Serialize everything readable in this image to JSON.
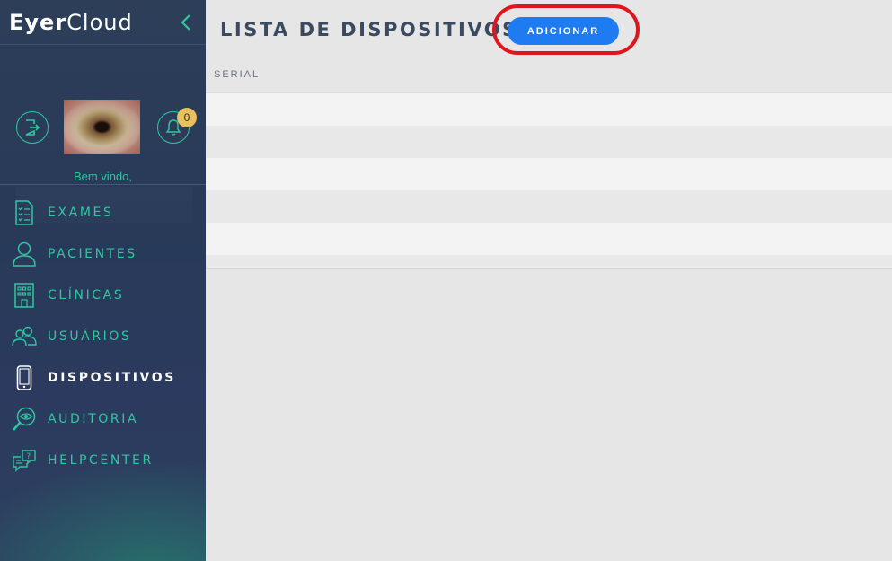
{
  "app": {
    "logo_bold": "Eyer",
    "logo_light": "Cloud"
  },
  "profile": {
    "welcome_text": "Bem vindo,",
    "notification_count": "0"
  },
  "sidebar": {
    "items": [
      {
        "label": "EXAMES",
        "icon": "exam-list-icon"
      },
      {
        "label": "PACIENTES",
        "icon": "patient-icon"
      },
      {
        "label": "CLÍNICAS",
        "icon": "clinic-building-icon"
      },
      {
        "label": "USUÁRIOS",
        "icon": "users-icon"
      },
      {
        "label": "DISPOSITIVOS",
        "icon": "device-icon",
        "active": true
      },
      {
        "label": "AUDITORIA",
        "icon": "audit-eye-icon"
      },
      {
        "label": "HELPCENTER",
        "icon": "helpcenter-chat-icon"
      }
    ]
  },
  "main": {
    "title": "LISTA DE DISPOSITIVOS",
    "add_button": "ADICIONAR",
    "table": {
      "columns": [
        "SERIAL"
      ],
      "rows": [
        [
          ""
        ],
        [
          ""
        ],
        [
          ""
        ],
        [
          ""
        ],
        [
          ""
        ]
      ]
    }
  },
  "colors": {
    "accent": "#2fc7a0",
    "primary_button": "#1e7bf2",
    "highlight": "#e0141c",
    "sidebar_bg": "#283a58"
  }
}
